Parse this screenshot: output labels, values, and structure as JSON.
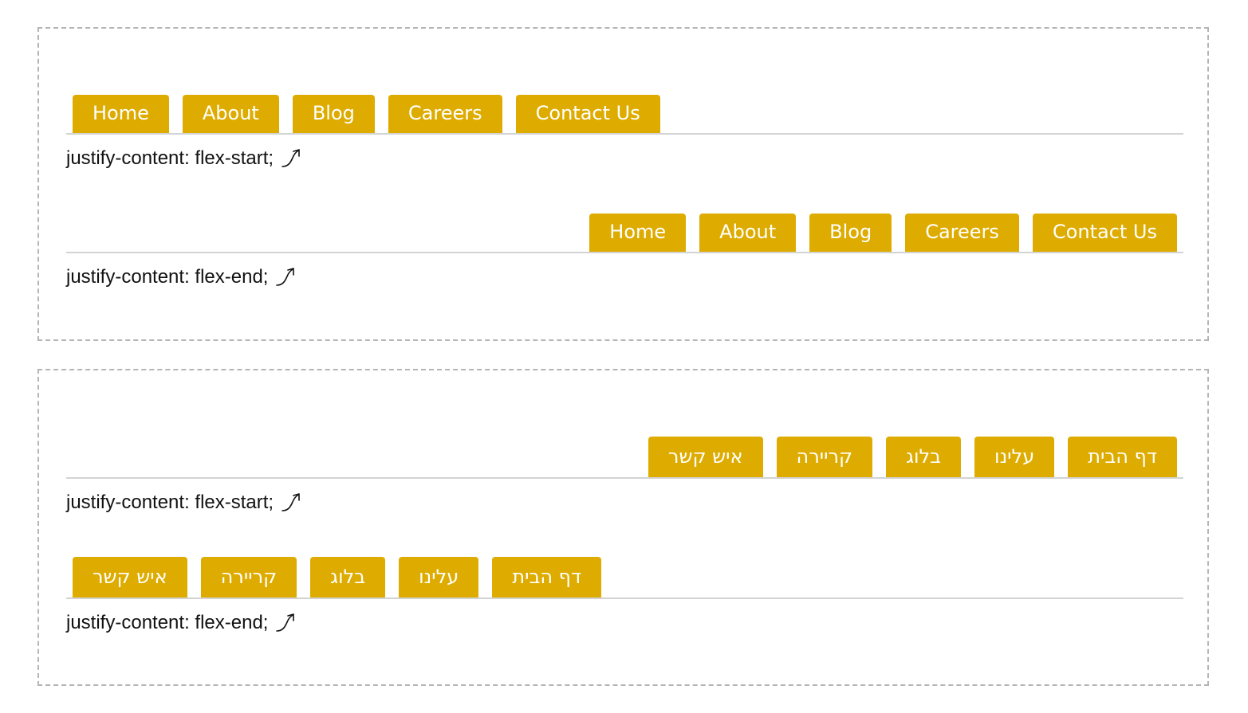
{
  "ltr_panel": {
    "demos": [
      {
        "tabs": [
          "Home",
          "About",
          "Blog",
          "Careers",
          "Contact Us"
        ],
        "caption": "justify-content: flex-start;"
      },
      {
        "tabs": [
          "Home",
          "About",
          "Blog",
          "Careers",
          "Contact Us"
        ],
        "caption": "justify-content: flex-end;"
      }
    ]
  },
  "rtl_panel": {
    "demos": [
      {
        "tabs": [
          "דף הבית",
          "עלינו",
          "בלוג",
          "קריירה",
          "איש קשר"
        ],
        "caption": "justify-content: flex-start;"
      },
      {
        "tabs": [
          "דף הבית",
          "עלינו",
          "בלוג",
          "קריירה",
          "איש קשר"
        ],
        "caption": "justify-content: flex-end;"
      }
    ]
  },
  "colors": {
    "tab_background": "#deac00",
    "tab_text": "#ffffff",
    "nav_border": "#d3d3d3",
    "panel_border": "#b5b5b5"
  },
  "icons": {
    "caption_arrow": "curved-arrow-up-right-icon"
  }
}
